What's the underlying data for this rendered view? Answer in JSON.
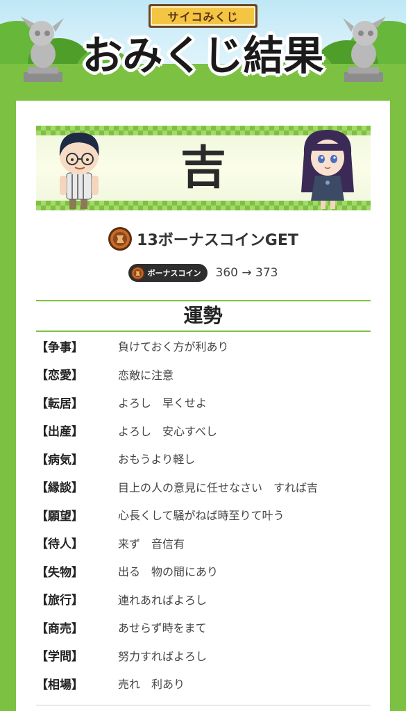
{
  "header": {
    "badge_label": "サイコみくじ",
    "title": "おみくじ結果"
  },
  "result": {
    "fortune": "吉"
  },
  "coins": {
    "bonus_text": "13ボーナスコインGET",
    "pill_label": "ボーナスコイン",
    "balance_text": "360 → 373"
  },
  "fortune_section": {
    "title": "運勢",
    "rows": [
      {
        "key": "【争事】",
        "value": "負けておく方が利あり"
      },
      {
        "key": "【恋愛】",
        "value": "恋敵に注意"
      },
      {
        "key": "【転居】",
        "value": "よろし　早くせよ"
      },
      {
        "key": "【出産】",
        "value": "よろし　安心すべし"
      },
      {
        "key": "【病気】",
        "value": "おもうより軽し"
      },
      {
        "key": "【縁談】",
        "value": "目上の人の意見に任せなさい　すれば吉"
      },
      {
        "key": "【願望】",
        "value": "心長くして騒がねば時至りて叶う"
      },
      {
        "key": "【待人】",
        "value": "来ず　音信有"
      },
      {
        "key": "【失物】",
        "value": "出る　物の間にあり"
      },
      {
        "key": "【旅行】",
        "value": "連れあればよろし"
      },
      {
        "key": "【商売】",
        "value": "あせらず時をまて"
      },
      {
        "key": "【学問】",
        "value": "努力すればよろし"
      },
      {
        "key": "【相場】",
        "value": "売れ　利あり"
      }
    ]
  },
  "colors": {
    "accent_green": "#7cc142",
    "badge_gold": "#f4c542",
    "coin_brown": "#8a4a1e"
  },
  "icons": [
    "statue-left-icon",
    "statue-right-icon",
    "coin-icon",
    "boy-character",
    "girl-character"
  ]
}
